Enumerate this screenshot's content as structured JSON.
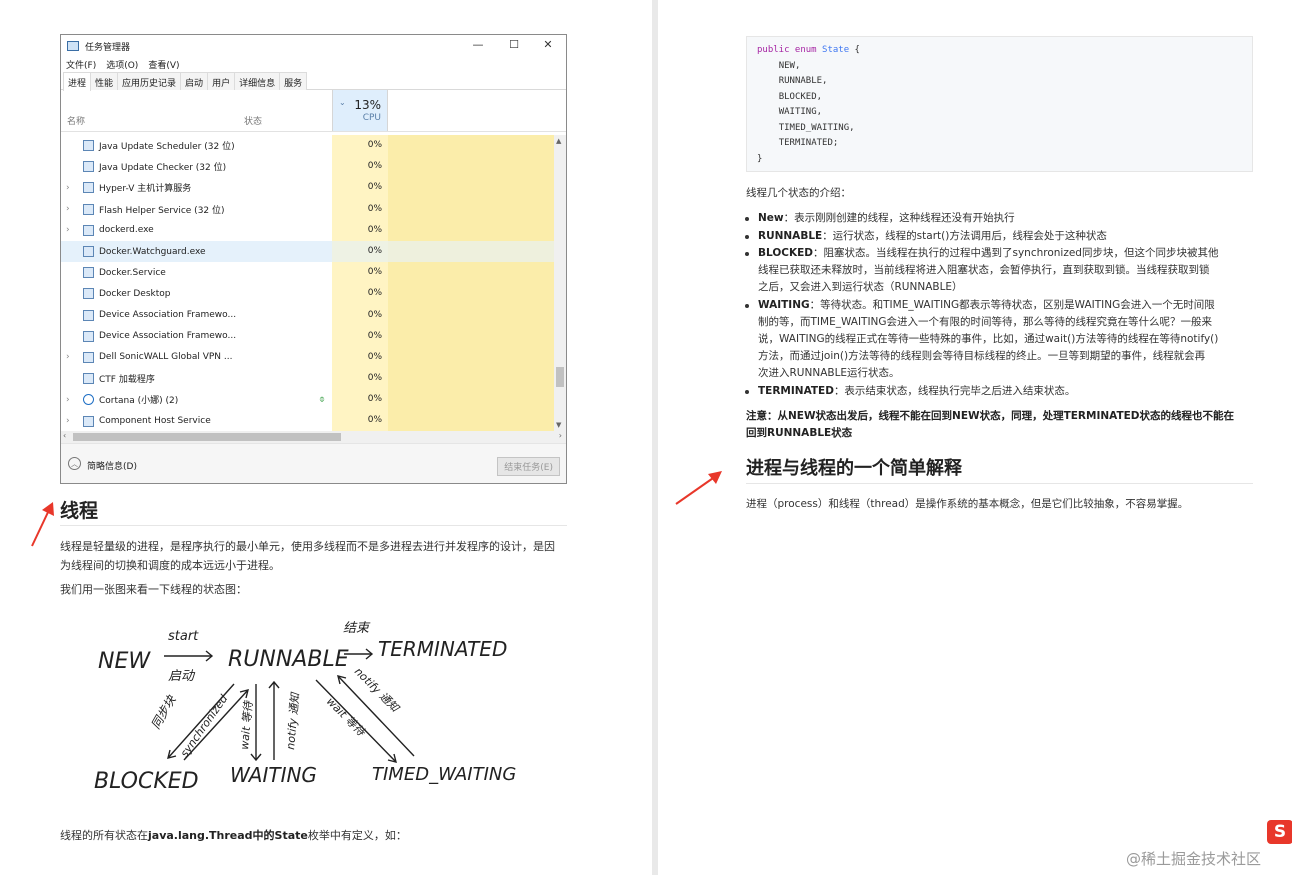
{
  "task_manager": {
    "title": "任务管理器",
    "menu": [
      "文件(F)",
      "选项(O)",
      "查看(V)"
    ],
    "tabs": [
      "进程",
      "性能",
      "应用历史记录",
      "启动",
      "用户",
      "详细信息",
      "服务"
    ],
    "active_tab": "进程",
    "columns": {
      "name": "名称",
      "status": "状态",
      "cpu_percent": "13%",
      "cpu": "CPU"
    },
    "rows": [
      {
        "name": "Java Update Scheduler (32 位)",
        "cpu": "0%",
        "expandable": false
      },
      {
        "name": "Java Update Checker (32 位)",
        "cpu": "0%",
        "expandable": false
      },
      {
        "name": "Hyper-V 主机计算服务",
        "cpu": "0%",
        "expandable": true
      },
      {
        "name": "Flash Helper Service (32 位)",
        "cpu": "0%",
        "expandable": true
      },
      {
        "name": "dockerd.exe",
        "cpu": "0%",
        "expandable": true
      },
      {
        "name": "Docker.Watchguard.exe",
        "cpu": "0%",
        "expandable": false,
        "selected": true
      },
      {
        "name": "Docker.Service",
        "cpu": "0%",
        "expandable": false
      },
      {
        "name": "Docker Desktop",
        "cpu": "0%",
        "expandable": false
      },
      {
        "name": "Device Association Framewo...",
        "cpu": "0%",
        "expandable": false
      },
      {
        "name": "Device Association Framewo...",
        "cpu": "0%",
        "expandable": false
      },
      {
        "name": "Dell SonicWALL Global VPN ...",
        "cpu": "0%",
        "expandable": true
      },
      {
        "name": "CTF 加载程序",
        "cpu": "0%",
        "expandable": false
      },
      {
        "name": "Cortana (小娜) (2)",
        "cpu": "0%",
        "expandable": true,
        "leaf": true
      },
      {
        "name": "Component Host Service",
        "cpu": "0%",
        "expandable": true
      }
    ],
    "footer": {
      "brief": "简略信息(D)",
      "end_task": "结束任务(E)"
    }
  },
  "left": {
    "heading": "线程",
    "para1_line1": "线程是轻量级的进程，是程序执行的最小单元，使用多线程而不是多进程去进行并发程序的设计，是因",
    "para1_line2": "为线程间的切换和调度的成本远远小于进程。",
    "para2": "我们用一张图来看一下线程的状态图：",
    "diagram": {
      "new": "NEW",
      "start": "start",
      "start_cn": "启动",
      "runnable": "RUNNABLE",
      "end_cn": "结束",
      "terminated": "TERMINATED",
      "sync_cn": "同步块",
      "sync": "synchronized",
      "wait_cn": "wait 等待",
      "notify_cn": "notify 通知",
      "wait2_cn": "wait 等待",
      "notify2_cn": "notify 通知",
      "blocked": "BLOCKED",
      "waiting": "WAITING",
      "timed_waiting": "TIMED_WAITING"
    },
    "para3_pre": "线程的所有状态在",
    "para3_bold": "java.lang.Thread中的State",
    "para3_post": "枚举中有定义，如："
  },
  "right": {
    "code": {
      "kw": "public enum",
      "name": "State",
      "open": "{",
      "items": [
        "NEW,",
        "RUNNABLE,",
        "BLOCKED,",
        "WAITING,",
        "TIMED_WAITING,",
        "TERMINATED;"
      ],
      "close": "}"
    },
    "intro": "线程几个状态的介绍：",
    "bullets": [
      {
        "term": "New",
        "lines": [
          "：表示刚刚创建的线程，这种线程还没有开始执行"
        ]
      },
      {
        "term": "RUNNABLE",
        "lines": [
          "：运行状态，线程的start()方法调用后，线程会处于这种状态"
        ]
      },
      {
        "term": "BLOCKED",
        "lines": [
          "：阻塞状态。当线程在执行的过程中遇到了synchronized同步块，但这个同步块被其他",
          "线程已获取还未释放时，当前线程将进入阻塞状态，会暂停执行，直到获取到锁。当线程获取到锁",
          "之后，又会进入到运行状态（RUNNABLE）"
        ]
      },
      {
        "term": "WAITING",
        "lines": [
          "：等待状态。和TIME_WAITING都表示等待状态，区别是WAITING会进入一个无时间限",
          "制的等，而TIME_WAITING会进入一个有限的时间等待，那么等待的线程究竟在等什么呢？一般来",
          "说，WAITING的线程正式在等待一些特殊的事件，比如，通过wait()方法等待的线程在等待notify()",
          "方法，而通过join()方法等待的线程则会等待目标线程的终止。一旦等到期望的事件，线程就会再",
          "次进入RUNNABLE运行状态。"
        ]
      },
      {
        "term": "TERMINATED",
        "lines": [
          "：表示结束状态，线程执行完毕之后进入结束状态。"
        ]
      }
    ],
    "note_line1": "注意：从NEW状态出发后，线程不能在回到NEW状态，同理，处理TERMINATED状态的线程也不能在",
    "note_line2": "回到RUNNABLE状态",
    "heading": "进程与线程的一个简单解释",
    "para": "进程（process）和线程（thread）是操作系统的基本概念，但是它们比较抽象，不容易掌握。"
  },
  "watermark": "@稀土掘金技术社区",
  "logo_letter": "S",
  "colors": {
    "arrow": "#e8372a",
    "cpu_fill": "#fbedaa",
    "selected": "#e5f1fb"
  }
}
